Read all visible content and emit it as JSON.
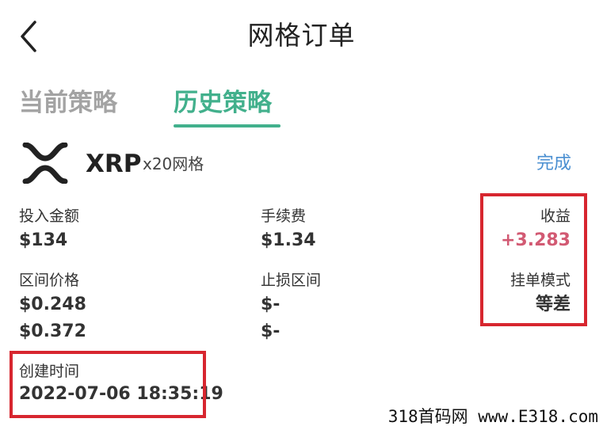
{
  "header": {
    "back_icon": "chevron-left-icon",
    "title": "网格订单"
  },
  "tabs": [
    {
      "label": "当前策略",
      "active": false
    },
    {
      "label": "历史策略",
      "active": true
    }
  ],
  "colors": {
    "accent": "#42b08c",
    "inactive_tab": "#a3a3a3",
    "link": "#4a8fd1",
    "profit": "#d25a73",
    "highlight": "#d7262f"
  },
  "order": {
    "coin_icon": "xrp-logo-icon",
    "symbol": "XRP",
    "grid_count": "x20网格",
    "status": "完成",
    "investment_label": "投入金额",
    "investment_value": "$134",
    "fee_label": "手续费",
    "fee_value": "$1.34",
    "profit_label": "收益",
    "profit_value": "+3.283",
    "price_range_label": "区间价格",
    "price_low": "$0.248",
    "price_high": "$0.372",
    "stop_loss_label": "止损区间",
    "stop_loss_low": "$-",
    "stop_loss_high": "$-",
    "order_mode_label": "挂单模式",
    "order_mode_value": "等差",
    "created_label": "创建时间",
    "created_value": "2022-07-06 18:35:19"
  },
  "watermark": "318首码网 www.E318.com"
}
